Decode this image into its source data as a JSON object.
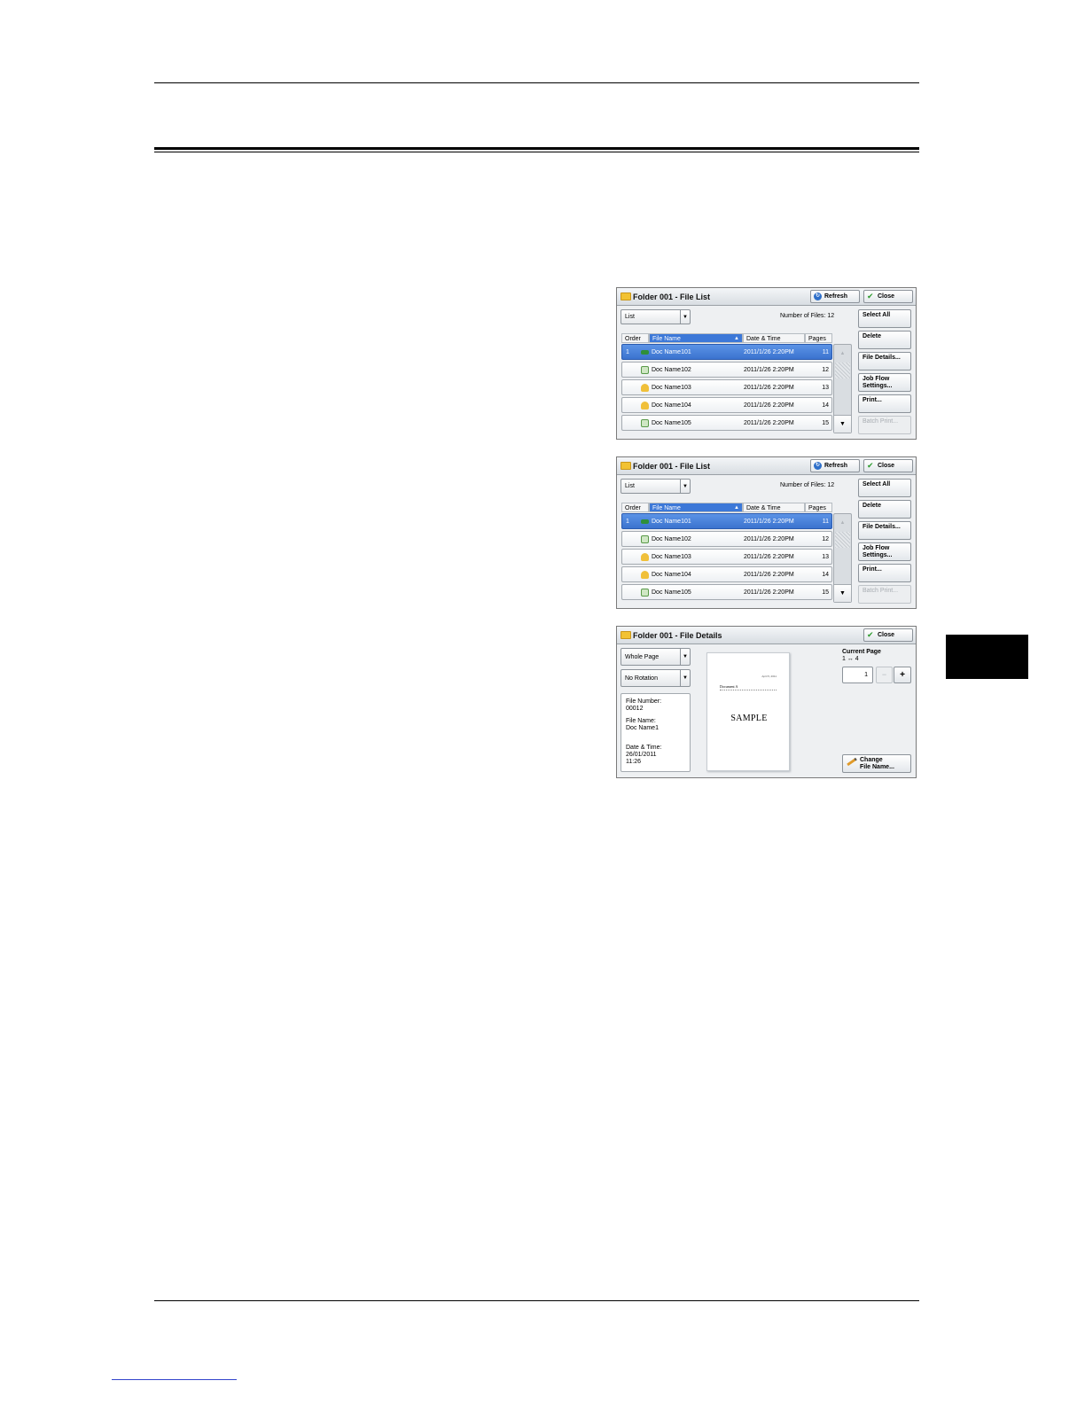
{
  "file_list_panels": [
    {
      "title": "Folder 001 - File List",
      "refresh_label": "Refresh",
      "close_label": "Close",
      "view_select": "List",
      "number_of_files_label": "Number of Files:",
      "number_of_files": "12",
      "columns": {
        "order": "Order",
        "file_name": "File Name",
        "date_time": "Date & Time",
        "pages": "Pages"
      },
      "rows": [
        {
          "order": "1",
          "icon": "box-icon",
          "name": "Doc Name101",
          "date": "2011/1/26  2:20PM",
          "pages": "11",
          "selected": true
        },
        {
          "order": "",
          "icon": "document-icon",
          "name": "Doc Name102",
          "date": "2011/1/26  2:20PM",
          "pages": "12",
          "selected": false
        },
        {
          "order": "",
          "icon": "user-icon",
          "name": "Doc Name103",
          "date": "2011/1/26  2:20PM",
          "pages": "13",
          "selected": false
        },
        {
          "order": "",
          "icon": "user-icon",
          "name": "Doc Name104",
          "date": "2011/1/26  2:20PM",
          "pages": "14",
          "selected": false
        },
        {
          "order": "",
          "icon": "document-icon",
          "name": "Doc Name105",
          "date": "2011/1/26  2:20PM",
          "pages": "15",
          "selected": false
        }
      ],
      "side_buttons": {
        "select_all": "Select All",
        "delete": "Delete",
        "file_details": "File Details...",
        "job_flow_1": "Job Flow",
        "job_flow_2": "Settings...",
        "print": "Print...",
        "batch_print": "Batch Print..."
      }
    },
    {
      "title": "Folder 001 - File List",
      "refresh_label": "Refresh",
      "close_label": "Close",
      "view_select": "List",
      "number_of_files_label": "Number of Files:",
      "number_of_files": "12",
      "columns": {
        "order": "Order",
        "file_name": "File Name",
        "date_time": "Date & Time",
        "pages": "Pages"
      },
      "rows": [
        {
          "order": "1",
          "icon": "box-icon",
          "name": "Doc Name101",
          "date": "2011/1/26  2:20PM",
          "pages": "11",
          "selected": true
        },
        {
          "order": "",
          "icon": "document-icon",
          "name": "Doc Name102",
          "date": "2011/1/26  2:20PM",
          "pages": "12",
          "selected": false
        },
        {
          "order": "",
          "icon": "user-icon",
          "name": "Doc Name103",
          "date": "2011/1/26  2:20PM",
          "pages": "13",
          "selected": false
        },
        {
          "order": "",
          "icon": "user-icon",
          "name": "Doc Name104",
          "date": "2011/1/26  2:20PM",
          "pages": "14",
          "selected": false
        },
        {
          "order": "",
          "icon": "document-icon",
          "name": "Doc Name105",
          "date": "2011/1/26  2:20PM",
          "pages": "15",
          "selected": false
        }
      ],
      "side_buttons": {
        "select_all": "Select All",
        "delete": "Delete",
        "file_details": "File Details...",
        "job_flow_1": "Job Flow",
        "job_flow_2": "Settings...",
        "print": "Print...",
        "batch_print": "Batch Print..."
      }
    }
  ],
  "details_panel": {
    "title": "Folder 001 - File Details",
    "close_label": "Close",
    "view_select": "Whole Page",
    "rotation_select": "No Rotation",
    "file_number_label": "File Number:",
    "file_number": "00012",
    "file_name_label": "File Name:",
    "file_name": "Doc Name1",
    "date_time_label": "Date & Time:",
    "date": "26/01/2011",
    "time": "11:26",
    "preview": {
      "date": "April 5, 2011",
      "heading": "Document A",
      "sample": "SAMPLE"
    },
    "current_page_label": "Current Page",
    "page_of": "1 ↔ 4",
    "current_page": "1",
    "minus": "−",
    "plus": "+",
    "change_name_1": "Change",
    "change_name_2": "File Name..."
  }
}
